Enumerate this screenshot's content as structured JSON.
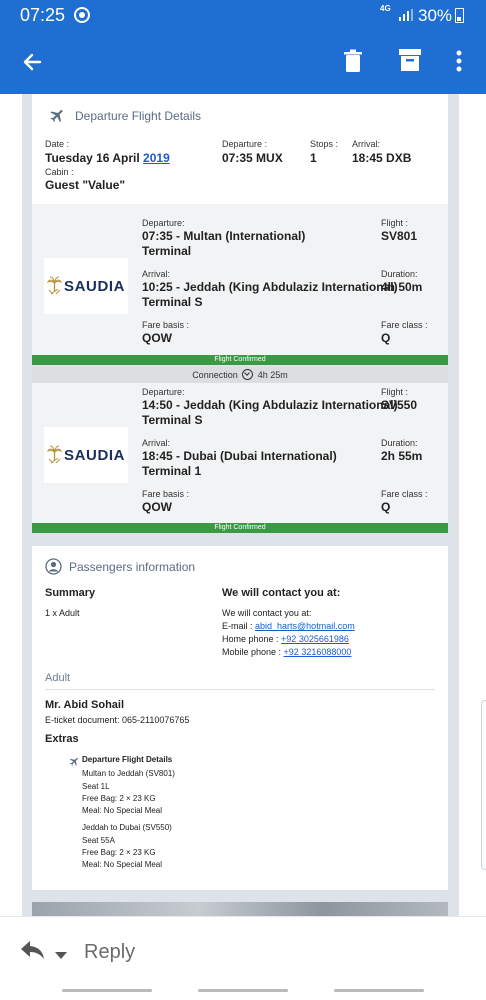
{
  "status_bar": {
    "time": "07:25",
    "network": "4G",
    "battery": "30%"
  },
  "app_bar": {
    "icons": [
      "arrow-left-icon",
      "trash-icon",
      "archive-icon",
      "more-vertical-icon"
    ]
  },
  "departure": {
    "section_title": "Departure Flight Details",
    "date_label": "Date :",
    "date_prefix": "Tuesday 16 April ",
    "date_year": "2019",
    "departure_label": "Departure :",
    "departure_value": "07:35 MUX",
    "stops_label": "Stops :",
    "stops_value": "1",
    "arrival_label": "Arrival:",
    "arrival_value": "18:45 DXB",
    "cabin_label": "Cabin :",
    "cabin_value": "Guest \"Value\""
  },
  "segments": [
    {
      "airline": "SAUDIA",
      "departure_label": "Departure:",
      "departure_line1": "07:35 - Multan (International)",
      "departure_line2": "Terminal",
      "flight_label": "Flight :",
      "flight_value": "SV801",
      "arrival_label": "Arrival:",
      "arrival_line1": "10:25 - Jeddah (King Abdulaziz International)",
      "arrival_line2": "Terminal S",
      "duration_label": "Duration:",
      "duration_value": "4h 50m",
      "fare_basis_label": "Fare basis :",
      "fare_basis_value": "QOW",
      "fare_class_label": "Fare class :",
      "fare_class_value": "Q",
      "status": "Flight Confirmed"
    },
    {
      "airline": "SAUDIA",
      "departure_label": "Departure:",
      "departure_line1": "14:50 - Jeddah (King Abdulaziz International)",
      "departure_line2": "Terminal S",
      "flight_label": "Flight :",
      "flight_value": "SV550",
      "arrival_label": "Arrival:",
      "arrival_line1": "18:45 - Dubai (Dubai International)",
      "arrival_line2": "Terminal 1",
      "duration_label": "Duration:",
      "duration_value": "2h 55m",
      "fare_basis_label": "Fare basis :",
      "fare_basis_value": "QOW",
      "fare_class_label": "Fare class :",
      "fare_class_value": "Q",
      "status": "Flight Confirmed"
    }
  ],
  "connection": {
    "label": "Connection",
    "duration": "4h 25m"
  },
  "passengers": {
    "section_title": "Passengers information",
    "summary_heading": "Summary",
    "summary_value": "1 x Adult",
    "contact_heading": "We will contact you at:",
    "contact_intro": "We will contact you at:",
    "email_label": "E-mail : ",
    "email": "abid_harts@hotmail.com",
    "home_phone_label": "Home phone : ",
    "home_phone": "+92 3025661986",
    "mobile_phone_label": "Mobile phone : ",
    "mobile_phone": "+92 3216088000",
    "adult_heading": "Adult",
    "passenger_name": "Mr. Abid Sohail",
    "eticket": "E-ticket document: 065-2110076765",
    "extras_heading": "Extras",
    "extras_title": "Departure Flight Details",
    "extras_seg1": [
      "Multan to Jeddah (SV801)",
      "Seat 1L",
      "Free Bag: 2 × 23 KG",
      "Meal: No Special Meal"
    ],
    "extras_seg2": [
      "Jeddah to Dubai (SV550)",
      "Seat 55A",
      "Free Bag: 2 × 23 KG",
      "Meal: No Special Meal"
    ]
  },
  "reply_bar": {
    "reply_label": "Reply"
  }
}
